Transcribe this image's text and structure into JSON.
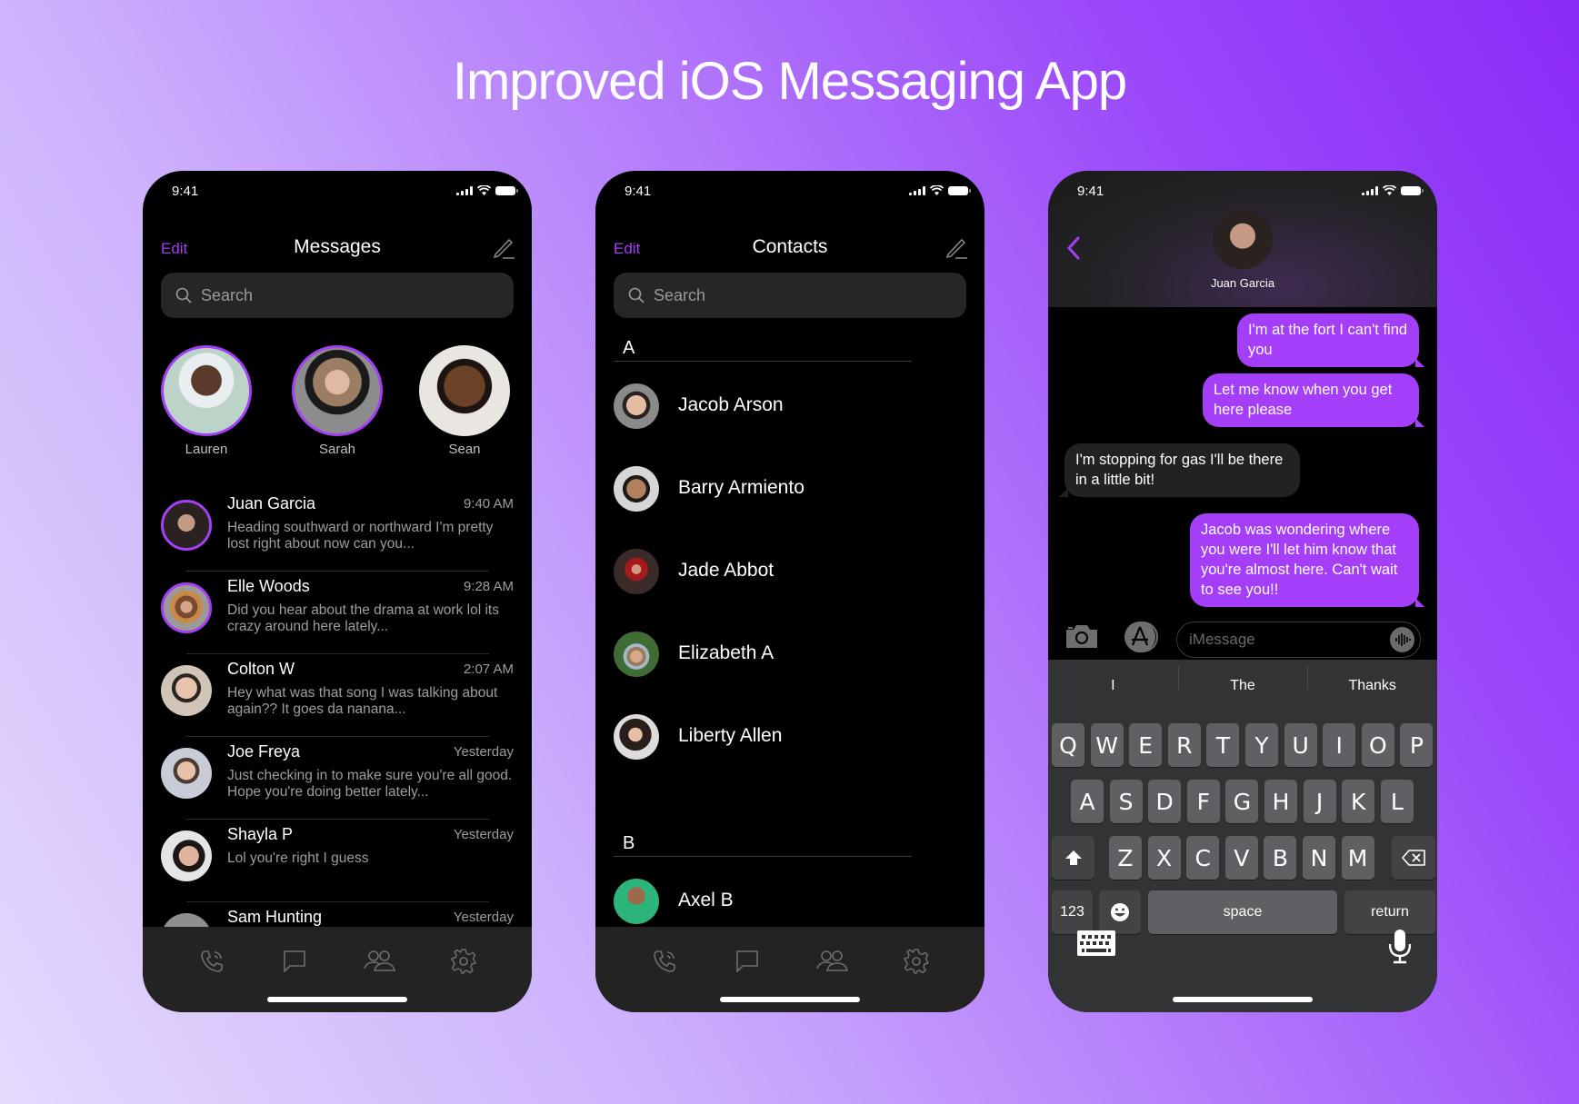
{
  "page": {
    "title": "Improved iOS Messaging App"
  },
  "colors": {
    "accent": "#a43ff5",
    "bubble_out": "#a53ef9",
    "bubble_in": "#222222",
    "tabbar": "#232323",
    "keyboard": "#323335"
  },
  "status": {
    "time": "9:41",
    "icons": [
      "signal-icon",
      "wifi-icon",
      "battery-icon"
    ]
  },
  "messages_screen": {
    "edit_label": "Edit",
    "title": "Messages",
    "compose_icon": "compose-icon",
    "search_placeholder": "Search",
    "stories": [
      {
        "name": "Lauren",
        "ring": true
      },
      {
        "name": "Sarah",
        "ring": true
      },
      {
        "name": "Sean",
        "ring": false
      }
    ],
    "conversations": [
      {
        "name": "Juan Garcia",
        "time": "9:40 AM",
        "preview": "Heading southward or northward I'm pretty lost right about now can you...",
        "ring": true
      },
      {
        "name": "Elle Woods",
        "time": "9:28 AM",
        "preview": "Did you hear about the drama at work lol its crazy around here lately...",
        "ring": true
      },
      {
        "name": "Colton W",
        "time": "2:07 AM",
        "preview": "Hey what was that song I was talking about again?? It goes da nanana...",
        "ring": false
      },
      {
        "name": "Joe Freya",
        "time": "Yesterday",
        "preview": "Just checking in to make sure you're all good. Hope you're doing better lately...",
        "ring": false
      },
      {
        "name": "Shayla P",
        "time": "Yesterday",
        "preview": "Lol you're right I guess",
        "ring": false
      },
      {
        "name": "Sam Hunting",
        "time": "Yesterday",
        "preview": "",
        "ring": false
      }
    ]
  },
  "contacts_screen": {
    "edit_label": "Edit",
    "title": "Contacts",
    "search_placeholder": "Search",
    "sections": [
      {
        "letter": "A",
        "contacts": [
          "Jacob Arson",
          "Barry Armiento",
          "Jade Abbot",
          "Elizabeth A",
          "Liberty Allen"
        ]
      },
      {
        "letter": "B",
        "contacts": [
          "Axel B"
        ]
      }
    ]
  },
  "tabbar": {
    "tabs": [
      "phone-icon",
      "chat-icon",
      "contacts-icon",
      "settings-icon"
    ]
  },
  "chat_screen": {
    "contact_name": "Juan Garcia",
    "messages": [
      {
        "direction": "out",
        "text": "I'm at the fort I can't find you"
      },
      {
        "direction": "out",
        "text": "Let me know when you get here please"
      },
      {
        "direction": "in",
        "text": "I'm stopping for gas I'll be there in a little bit!"
      },
      {
        "direction": "out",
        "text": "Jacob was wondering where you were I'll let him know that you're almost here. Can't wait to see you!!"
      }
    ],
    "input_placeholder": "iMessage",
    "suggestions": [
      "I",
      "The",
      "Thanks"
    ],
    "keyboard": {
      "row1": [
        "Q",
        "W",
        "E",
        "R",
        "T",
        "Y",
        "U",
        "I",
        "O",
        "P"
      ],
      "row2": [
        "A",
        "S",
        "D",
        "F",
        "G",
        "H",
        "J",
        "K",
        "L"
      ],
      "row3": [
        "Z",
        "X",
        "C",
        "V",
        "B",
        "N",
        "M"
      ],
      "numbers_label": "123",
      "space_label": "space",
      "return_label": "return"
    }
  }
}
